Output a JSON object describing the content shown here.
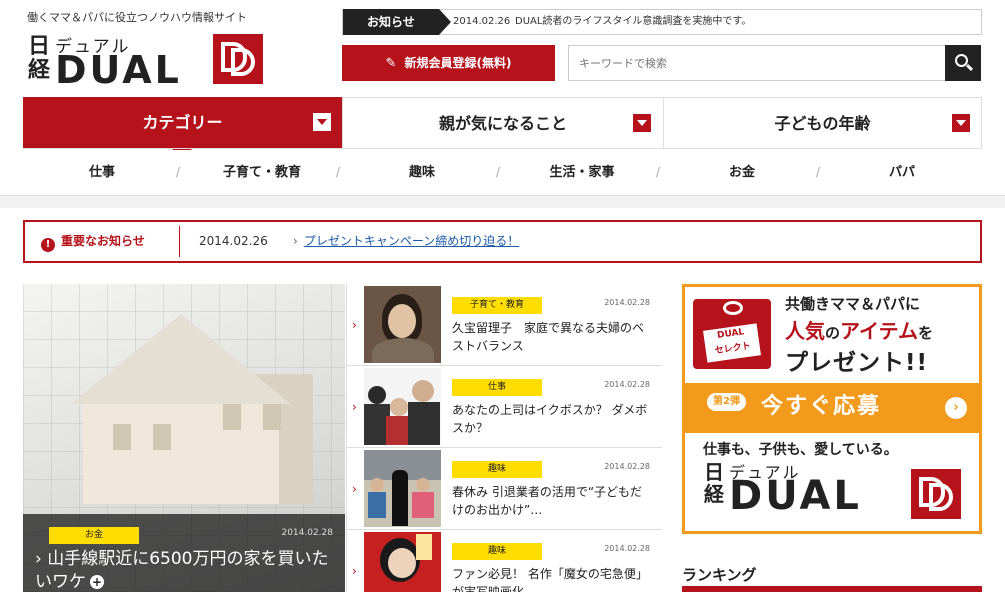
{
  "header": {
    "tagline": "働くママ＆パパに役立つノウハウ情報サイト",
    "logo": {
      "kanji": "日\n経",
      "kana": "デュアル",
      "word": "DUAL"
    }
  },
  "news": {
    "label": "お知らせ",
    "date": "2014.02.26",
    "text": "DUAL読者のライフスタイル意識調査を実施中です。"
  },
  "register_label": "新規会員登録(無料)",
  "search": {
    "placeholder": "キーワードで検索"
  },
  "main_tabs": [
    {
      "label": "カテゴリー"
    },
    {
      "label": "親が気になること"
    },
    {
      "label": "子どもの年齢"
    }
  ],
  "subnav": [
    "仕事",
    "子育て・教育",
    "趣味",
    "生活・家事",
    "お金",
    "パパ"
  ],
  "subnav_sep": "/",
  "important": {
    "label": "重要なお知らせ",
    "date": "2014.02.26",
    "link": "プレゼントキャンペーン締め切り迫る！"
  },
  "hero": {
    "category": "お金",
    "date": "2014.02.28",
    "title": "山手線駅近に6500万円の家を買いたいワケ"
  },
  "articles": [
    {
      "category": "子育て・教育",
      "date": "2014.02.28",
      "title": "久宝留理子　家庭で異なる夫婦のベストバランス"
    },
    {
      "category": "仕事",
      "date": "2014.02.28",
      "title": "あなたの上司はイクボスか？ ダメボスか？"
    },
    {
      "category": "趣味",
      "date": "2014.02.28",
      "title": "春休み 引退業者の活用で“子どもだけのお出かけ”…"
    },
    {
      "category": "趣味",
      "date": "2014.02.28",
      "title": "ファン必見！ 名作「魔女の宅急便」が実写映画化"
    }
  ],
  "promo": {
    "gift_label": "DUAL\nセレクト",
    "line1": "共働きママ＆パパに",
    "line2_red1": "人気",
    "line2_black": "の",
    "line2_red2": "アイテム",
    "line2_black2": "を",
    "line3": "プレゼント!!",
    "badge": "第2弾",
    "cta": "今すぐ応募",
    "tagline": "仕事も、子供も、愛している。",
    "logo": {
      "kanji": "日\n経",
      "kana": "デュアル",
      "word": "DUAL"
    }
  },
  "ranking_title": "ランキング",
  "colors": {
    "brand_red": "#b5121b",
    "category_yellow": "#ffdd00",
    "promo_orange": "#f29a1c"
  }
}
